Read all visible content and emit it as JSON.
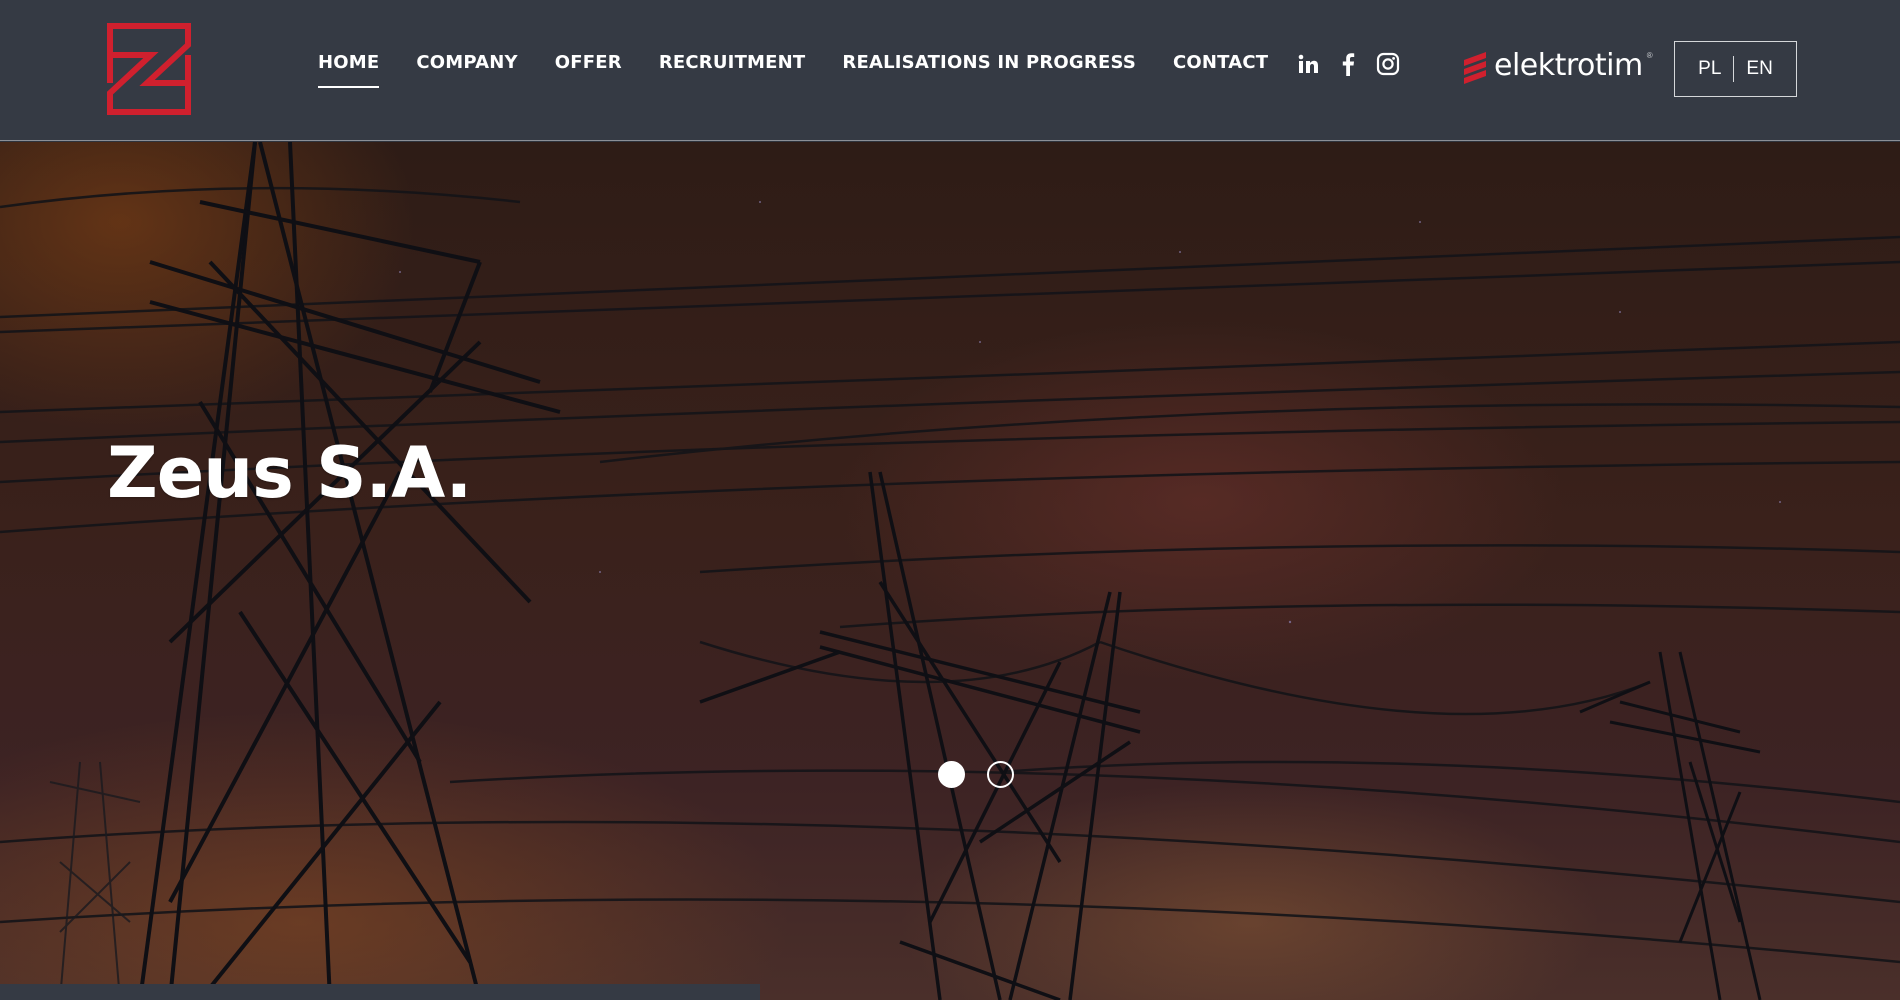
{
  "brand": {
    "logo_icon": "zeus-z-logo-icon",
    "partner_name": "elektrotim",
    "partner_tm": "®",
    "accent_color": "#d0202e"
  },
  "nav": {
    "items": [
      {
        "label": "HOME",
        "active": true
      },
      {
        "label": "COMPANY",
        "active": false
      },
      {
        "label": "OFFER",
        "active": false
      },
      {
        "label": "RECRUITMENT",
        "active": false
      },
      {
        "label": "REALISATIONS IN PROGRESS",
        "active": false
      },
      {
        "label": "CONTACT",
        "active": false
      }
    ]
  },
  "social": [
    {
      "icon": "linkedin-icon"
    },
    {
      "icon": "facebook-icon"
    },
    {
      "icon": "instagram-icon"
    }
  ],
  "language": {
    "options": [
      "PL",
      "EN"
    ]
  },
  "hero": {
    "title": "Zeus S.A.",
    "slides_total": 2,
    "active_slide": 1
  }
}
